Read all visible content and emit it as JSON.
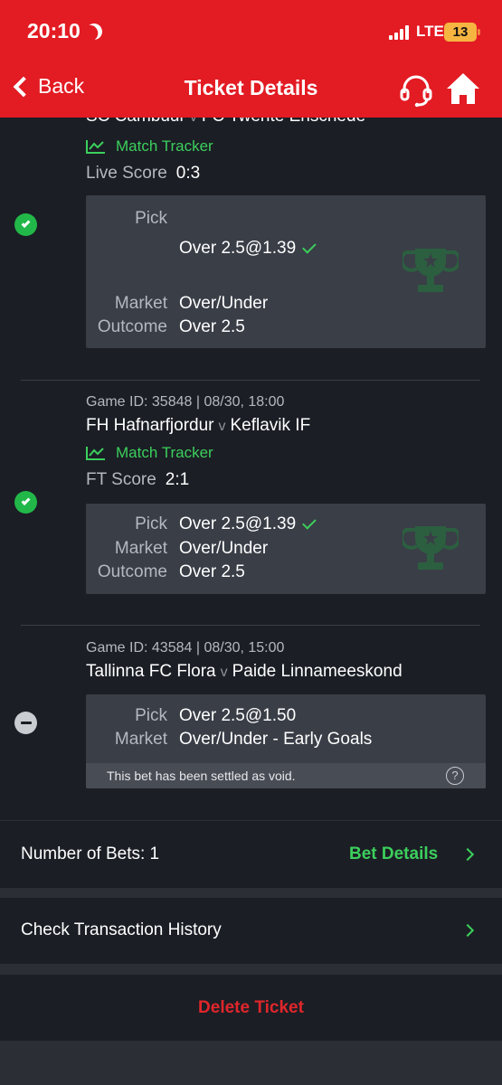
{
  "status_bar": {
    "time": "20:10",
    "network": "LTE",
    "battery": "13"
  },
  "header": {
    "back_label": "Back",
    "title": "Ticket Details"
  },
  "games": [
    {
      "teams_home": "SC Cambuur",
      "teams_sep": "v",
      "teams_away": "FC Twente Enschede",
      "tracker_label": "Match Tracker",
      "score_label": "Live Score",
      "score_value": "0:3",
      "pick_label": "Pick",
      "pick_value": "Over 2.5@1.39",
      "market_label": "Market",
      "market_value": "Over/Under",
      "outcome_label": "Outcome",
      "outcome_value": "Over 2.5",
      "status": "won"
    },
    {
      "game_id": "Game ID: 35848 | 08/30, 18:00",
      "teams_home": "FH Hafnarfjordur",
      "teams_sep": "v",
      "teams_away": "Keflavik IF",
      "tracker_label": "Match Tracker",
      "score_label": "FT Score",
      "score_value": "2:1",
      "pick_label": "Pick",
      "pick_value": "Over 2.5@1.39",
      "market_label": "Market",
      "market_value": "Over/Under",
      "outcome_label": "Outcome",
      "outcome_value": "Over 2.5",
      "status": "won"
    },
    {
      "game_id": "Game ID: 43584 | 08/30, 15:00",
      "teams_home": "Tallinna FC Flora",
      "teams_sep": "v",
      "teams_away": "Paide Linnameeskond",
      "pick_label": "Pick",
      "pick_value": "Over 2.5@1.50",
      "market_label": "Market",
      "market_value": "Over/Under - Early Goals",
      "void_note": "This bet has been settled as void.",
      "help_symbol": "?",
      "status": "void"
    }
  ],
  "summary": {
    "bets_label": "Number of Bets: 1",
    "bet_details_link": "Bet Details",
    "transaction_history": "Check Transaction History",
    "delete_ticket": "Delete Ticket"
  },
  "colors": {
    "brand": "#e31b23",
    "accent_green": "#3ccf5c",
    "background": "#1b1e25",
    "card": "#3a3e47",
    "danger": "#e0262b"
  }
}
